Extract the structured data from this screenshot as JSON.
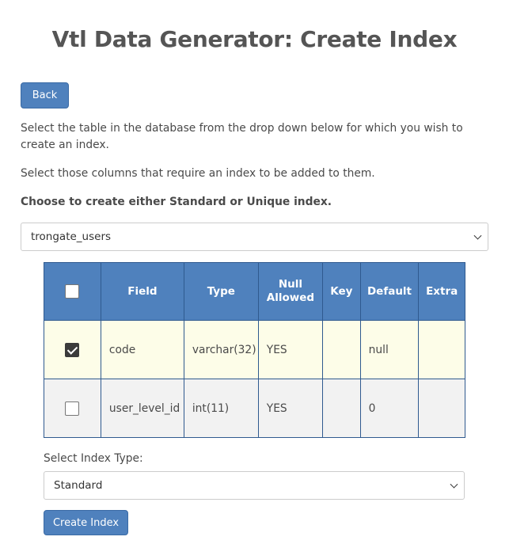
{
  "page": {
    "title": "Vtl Data Generator: Create Index"
  },
  "back_label": "Back",
  "instructions": [
    "Select the table in the database from the drop down below for which you wish to create an index.",
    "Select those columns that require an index to be added to them.",
    "Choose to create either Standard or Unique index."
  ],
  "table_select": {
    "value": "trongate_users"
  },
  "columns_table": {
    "headers": {
      "field": "Field",
      "type": "Type",
      "null_allowed": "Null Allowed",
      "key": "Key",
      "default": "Default",
      "extra": "Extra"
    },
    "header_checked": false,
    "rows": [
      {
        "checked": true,
        "field": "code",
        "type": "varchar(32)",
        "null_allowed": "YES",
        "key": "",
        "default": "null",
        "extra": ""
      },
      {
        "checked": false,
        "field": "user_level_id",
        "type": "int(11)",
        "null_allowed": "YES",
        "key": "",
        "default": "0",
        "extra": ""
      }
    ]
  },
  "index_type": {
    "label": "Select Index Type:",
    "value": "Standard"
  },
  "create_label": "Create Index",
  "colors": {
    "primary": "#4f81bd",
    "row_highlight": "#fdfde8",
    "row_alt": "#f2f2f2"
  }
}
